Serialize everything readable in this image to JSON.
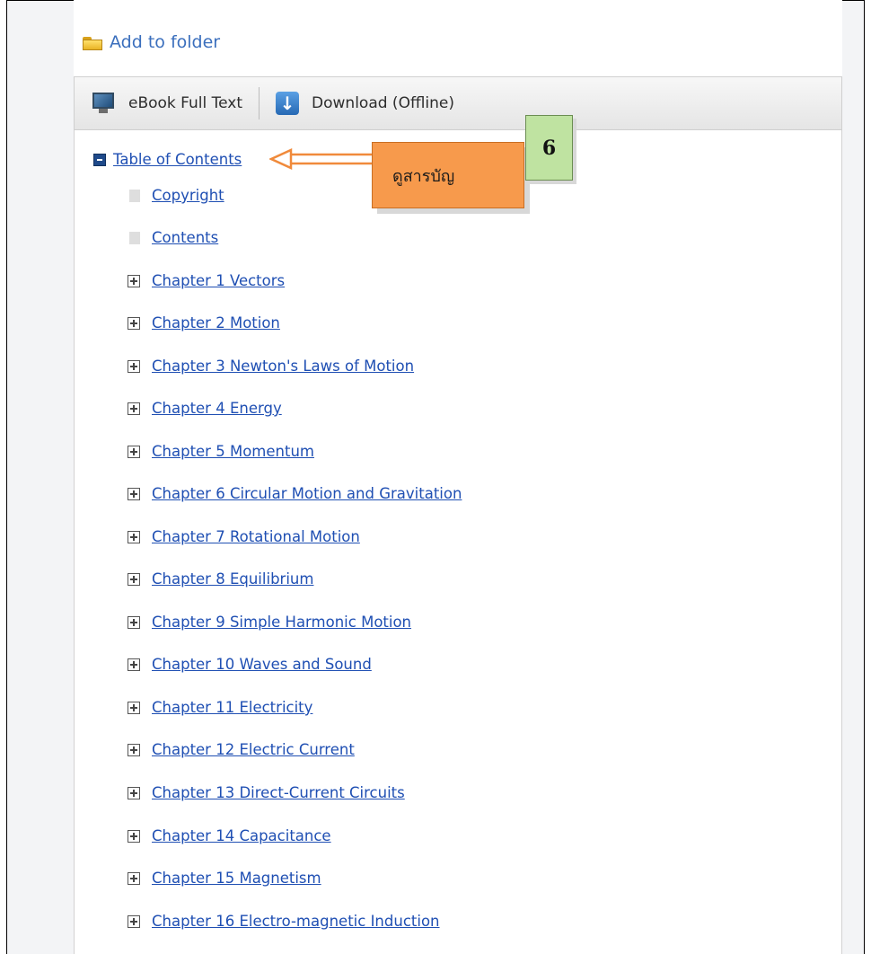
{
  "header": {
    "add_to_folder": "Add to folder"
  },
  "toolbar": {
    "ebook_full_text": "eBook Full Text",
    "download_offline": "Download (Offline)"
  },
  "toc": {
    "title": "Table of Contents",
    "leaves": [
      "Copyright",
      "Contents"
    ],
    "chapters": [
      "Chapter 1 Vectors",
      "Chapter 2 Motion",
      "Chapter 3 Newton's Laws of Motion",
      "Chapter 4 Energy",
      "Chapter 5 Momentum",
      "Chapter 6 Circular Motion and Gravitation",
      "Chapter 7 Rotational Motion",
      "Chapter 8 Equilibrium",
      "Chapter 9 Simple Harmonic Motion",
      "Chapter 10 Waves and Sound",
      "Chapter 11 Electricity",
      "Chapter 12 Electric Current",
      "Chapter 13 Direct-Current Circuits",
      "Chapter 14 Capacitance",
      "Chapter 15 Magnetism",
      "Chapter 16 Electro-magnetic Induction"
    ]
  },
  "annotation": {
    "callout_text": "ดูสารบัญ",
    "step_number": "6",
    "callout_color": "#f79a4c",
    "badge_color": "#bfe3a1",
    "arrow_color": "#f08a3b"
  }
}
